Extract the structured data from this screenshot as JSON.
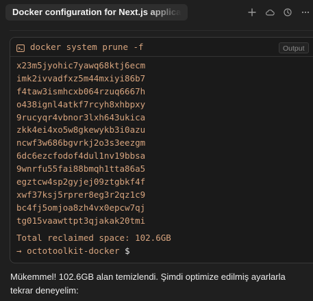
{
  "header": {
    "title": "Docker configuration for Next.js application",
    "actions": [
      {
        "name": "add-icon"
      },
      {
        "name": "cloud-icon"
      },
      {
        "name": "history-icon"
      },
      {
        "name": "more-icon"
      }
    ]
  },
  "terminal": {
    "icon": "terminal-icon",
    "command": "docker system prune -f",
    "badge": "Output",
    "output_lines": [
      "x23m5jyohic7yawq68ktj6ecm",
      "imk2ivvadfxz5m44mxiyi86b7",
      "f4taw3ismhcxb064rzuq6667h",
      "o438ignl4atkf7rcyh8xhbpxy",
      "9rucyqr4vbnor3lxh643ukica",
      "zkk4ei4xo5w8gkewykb3i0azu",
      "ncwf3w686bgvrkj2o3s3eezgm",
      "6dc6ezcfodof4dul1nv19bbsa",
      "9wnrfu55fai88bmqh1tta86a5",
      "egztcw4sp2gyjej09ztgbkf4f",
      "xwf37ksj5rprer8eg3r2qz1c9",
      "bc4fj5omjoa8zh4vx0epcw7qj",
      "tg015vaawttpt3qjakak20tmi"
    ],
    "summary": "Total reclaimed space: 102.6GB",
    "prompt_arrow": "→",
    "prompt_dir": "octotoolkit-docker",
    "prompt_symbol": "$"
  },
  "message": {
    "text": "Mükemmel! 102.6GB alan temizlendi. Şimdi optimize edilmiş ayarlarla tekrar deneyelim:"
  }
}
